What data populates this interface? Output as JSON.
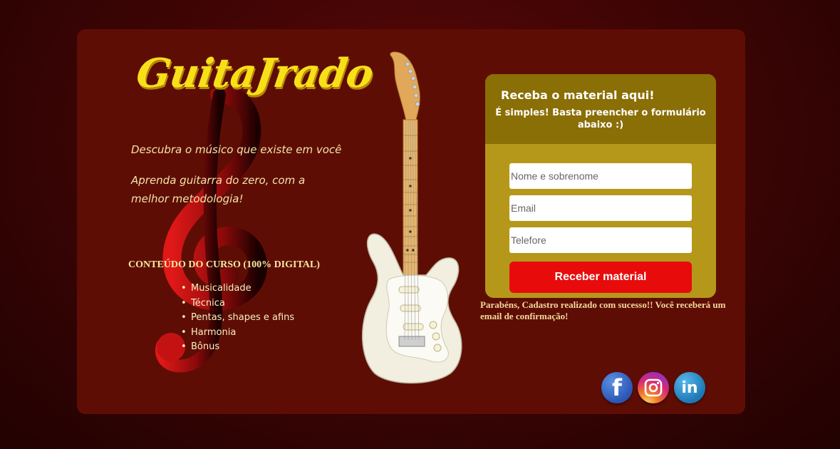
{
  "brand": {
    "logo_text": "GuitaJrado"
  },
  "hero": {
    "tagline_1": "Descubra o músico que existe em você",
    "tagline_2": "Aprenda guitarra do zero, com a melhor metodologia!"
  },
  "course": {
    "title": "CONTEÚDO DO CURSO (100% DIGITAL)",
    "items": [
      "Musicalidade",
      "Técnica",
      "Pentas, shapes e afins",
      "Harmonia",
      "Bônus"
    ]
  },
  "form": {
    "title": "Receba o material aqui!",
    "subtitle": "É simples! Basta preencher o formulário abaixo :)",
    "name_placeholder": "Nome e sobrenome",
    "email_placeholder": "Email",
    "phone_placeholder": "Telefore",
    "submit_label": "Receber material",
    "success_message": "Parabéns, Cadastro realizado com sucesso!! Você receberá um email de confirmação!"
  },
  "social": [
    {
      "name": "facebook-icon",
      "glyph": "f"
    },
    {
      "name": "instagram-icon",
      "glyph": ""
    },
    {
      "name": "linkedin-icon",
      "glyph": "in"
    }
  ],
  "colors": {
    "page_bg": "#3a0404",
    "card_bg": "#5e0d05",
    "logo": "#f7e018",
    "form_bg": "#b5981a",
    "form_header_bg": "#8a6e06",
    "submit_bg": "#e80b0b"
  }
}
